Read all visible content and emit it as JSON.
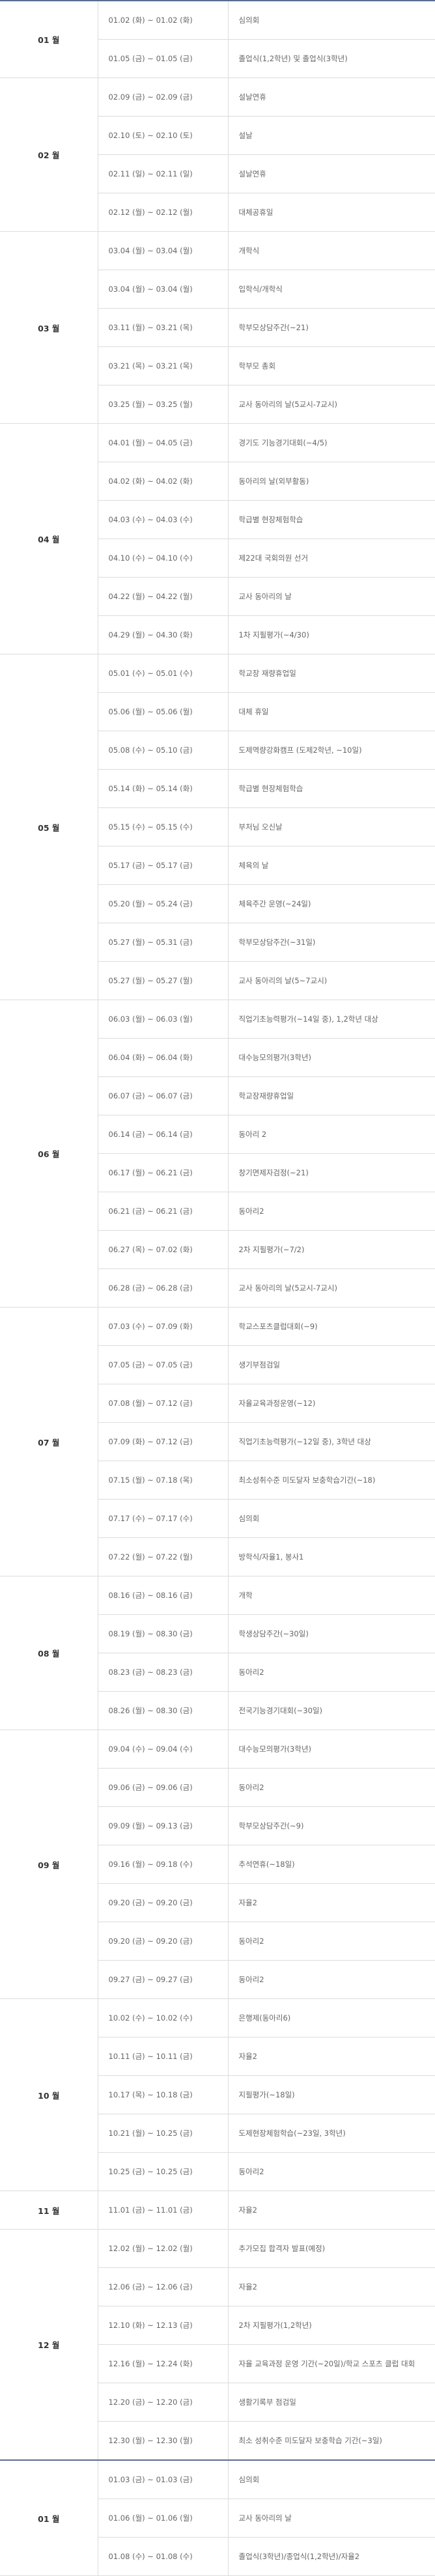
{
  "months": [
    {
      "label": "01 월",
      "rows": [
        {
          "date": "01.02 (화) ~ 01.02 (화)",
          "event": "심의회"
        },
        {
          "date": "01.05 (금) ~ 01.05 (금)",
          "event": "졸업식(1,2학년) 및 졸업식(3학년)"
        }
      ]
    },
    {
      "label": "02 월",
      "rows": [
        {
          "date": "02.09 (금) ~ 02.09 (금)",
          "event": "설날연휴"
        },
        {
          "date": "02.10 (토) ~ 02.10 (토)",
          "event": "설날"
        },
        {
          "date": "02.11 (일) ~ 02.11 (일)",
          "event": "설날연휴"
        },
        {
          "date": "02.12 (월) ~ 02.12 (월)",
          "event": "대체공휴일"
        }
      ]
    },
    {
      "label": "03 월",
      "rows": [
        {
          "date": "03.04 (월) ~ 03.04 (월)",
          "event": "개학식"
        },
        {
          "date": "03.04 (월) ~ 03.04 (월)",
          "event": "입학식/개학식"
        },
        {
          "date": "03.11 (월) ~ 03.21 (목)",
          "event": "학부모상담주간(~21)"
        },
        {
          "date": "03.21 (목) ~ 03.21 (목)",
          "event": "학부모 총회"
        },
        {
          "date": "03.25 (월) ~ 03.25 (월)",
          "event": "교사 동아리의 날(5교시-7교시)"
        }
      ]
    },
    {
      "label": "04 월",
      "rows": [
        {
          "date": "04.01 (월) ~ 04.05 (금)",
          "event": "경기도 기능경기대회(~4/5)"
        },
        {
          "date": "04.02 (화) ~ 04.02 (화)",
          "event": "동아리의 날(외부활동)"
        },
        {
          "date": "04.03 (수) ~ 04.03 (수)",
          "event": "학급별 현장체험학습"
        },
        {
          "date": "04.10 (수) ~ 04.10 (수)",
          "event": "제22대 국회의원 선거"
        },
        {
          "date": "04.22 (월) ~ 04.22 (월)",
          "event": "교사 동아리의 날"
        },
        {
          "date": "04.29 (월) ~ 04.30 (화)",
          "event": "1차 지필평가(~4/30)"
        }
      ]
    },
    {
      "label": "05 월",
      "rows": [
        {
          "date": "05.01 (수) ~ 05.01 (수)",
          "event": "학교장 재량휴업일"
        },
        {
          "date": "05.06 (월) ~ 05.06 (월)",
          "event": "대체 휴일"
        },
        {
          "date": "05.08 (수) ~ 05.10 (금)",
          "event": "도제역량강화캠프 (도제2학년, ~10일)"
        },
        {
          "date": "05.14 (화) ~ 05.14 (화)",
          "event": "학급별 현장체험학습"
        },
        {
          "date": "05.15 (수) ~ 05.15 (수)",
          "event": "부처님 오신날"
        },
        {
          "date": "05.17 (금) ~ 05.17 (금)",
          "event": "체육의 날"
        },
        {
          "date": "05.20 (월) ~ 05.24 (금)",
          "event": "체육주간 운영(~24일)"
        },
        {
          "date": "05.27 (월) ~ 05.31 (금)",
          "event": "학부모상담주간(~31일)"
        },
        {
          "date": "05.27 (월) ~ 05.27 (월)",
          "event": "교사 동아리의 날(5~7교시)"
        }
      ]
    },
    {
      "label": "06 월",
      "rows": [
        {
          "date": "06.03 (월) ~ 06.03 (월)",
          "event": "직업기초능력평가(~14일 중), 1,2학년 대상"
        },
        {
          "date": "06.04 (화) ~ 06.04 (화)",
          "event": "대수능모의평가(3학년)"
        },
        {
          "date": "06.07 (금) ~ 06.07 (금)",
          "event": "학교장재량휴업일"
        },
        {
          "date": "06.14 (금) ~ 06.14 (금)",
          "event": "동아리 2"
        },
        {
          "date": "06.17 (월) ~ 06.21 (금)",
          "event": "창기면제자검정(~21)"
        },
        {
          "date": "06.21 (금) ~ 06.21 (금)",
          "event": "동아리2"
        },
        {
          "date": "06.27 (목) ~ 07.02 (화)",
          "event": "2차 지필평가(~7/2)"
        },
        {
          "date": "06.28 (금) ~ 06.28 (금)",
          "event": "교사 동아리의 날(5교시-7교시)"
        }
      ]
    },
    {
      "label": "07 월",
      "rows": [
        {
          "date": "07.03 (수) ~ 07.09 (화)",
          "event": "학교스포츠클럽대회(~9)"
        },
        {
          "date": "07.05 (금) ~ 07.05 (금)",
          "event": "생기부점검일"
        },
        {
          "date": "07.08 (월) ~ 07.12 (금)",
          "event": "자율교육과정운영(~12)"
        },
        {
          "date": "07.09 (화) ~ 07.12 (금)",
          "event": "직업기초능력평가(~12일 중), 3학년 대상"
        },
        {
          "date": "07.15 (월) ~ 07.18 (목)",
          "event": "최소성취수준 미도달자 보충학습기간(~18)"
        },
        {
          "date": "07.17 (수) ~ 07.17 (수)",
          "event": "심의회"
        },
        {
          "date": "07.22 (월) ~ 07.22 (월)",
          "event": "방학식/자율1, 봉사1"
        }
      ]
    },
    {
      "label": "08 월",
      "rows": [
        {
          "date": "08.16 (금) ~ 08.16 (금)",
          "event": "개학"
        },
        {
          "date": "08.19 (월) ~ 08.30 (금)",
          "event": "학생상담주간(~30일)"
        },
        {
          "date": "08.23 (금) ~ 08.23 (금)",
          "event": "동아리2"
        },
        {
          "date": "08.26 (월) ~ 08.30 (금)",
          "event": "전국기능경기대회(~30일)"
        }
      ]
    },
    {
      "label": "09 월",
      "rows": [
        {
          "date": "09.04 (수) ~ 09.04 (수)",
          "event": "대수능모의평가(3학년)"
        },
        {
          "date": "09.06 (금) ~ 09.06 (금)",
          "event": "동아리2"
        },
        {
          "date": "09.09 (월) ~ 09.13 (금)",
          "event": "학부모상담주간(~9)"
        },
        {
          "date": "09.16 (월) ~ 09.18 (수)",
          "event": "추석연휴(~18일)"
        },
        {
          "date": "09.20 (금) ~ 09.20 (금)",
          "event": "자율2"
        },
        {
          "date": "09.20 (금) ~ 09.20 (금)",
          "event": "동아리2"
        },
        {
          "date": "09.27 (금) ~ 09.27 (금)",
          "event": "동아리2"
        }
      ]
    },
    {
      "label": "10 월",
      "rows": [
        {
          "date": "10.02 (수) ~ 10.02 (수)",
          "event": "은행제(동아리6)"
        },
        {
          "date": "10.11 (금) ~ 10.11 (금)",
          "event": "자율2"
        },
        {
          "date": "10.17 (목) ~ 10.18 (금)",
          "event": "지필평가(~18일)"
        },
        {
          "date": "10.21 (월) ~ 10.25 (금)",
          "event": "도제현장체험학습(~23일, 3학년)"
        },
        {
          "date": "10.25 (금) ~ 10.25 (금)",
          "event": "동아리2"
        }
      ]
    },
    {
      "label": "11 월",
      "rows": [
        {
          "date": "11.01 (금) ~ 11.01 (금)",
          "event": "자율2"
        }
      ]
    },
    {
      "label": "12 월",
      "rows": [
        {
          "date": "12.02 (월) ~ 12.02 (월)",
          "event": "추가모집 합격자 발표(예정)"
        },
        {
          "date": "12.06 (금) ~ 12.06 (금)",
          "event": "자율2"
        },
        {
          "date": "12.10 (화) ~ 12.13 (금)",
          "event": "2차 지필평가(1,2학년)"
        },
        {
          "date": "12.16 (월) ~ 12.24 (화)",
          "event": "자율 교육과정 운영 기간(~20일)/학교 스포츠 클럽 대회"
        },
        {
          "date": "12.20 (금) ~ 12.20 (금)",
          "event": "생활기록부 점검일"
        },
        {
          "date": "12.30 (월) ~ 12.30 (월)",
          "event": "최소 성취수준 미도달자 보충학습 기간(~3일)"
        }
      ]
    },
    {
      "label": "01 월",
      "rows": [
        {
          "date": "01.03 (금) ~ 01.03 (금)",
          "event": "심의회"
        },
        {
          "date": "01.06 (월) ~ 01.06 (월)",
          "event": "교사 동아리의 날"
        },
        {
          "date": "01.08 (수) ~ 01.08 (수)",
          "event": "졸업식(3학년)/종업식(1,2학년)/자율2"
        }
      ]
    }
  ]
}
